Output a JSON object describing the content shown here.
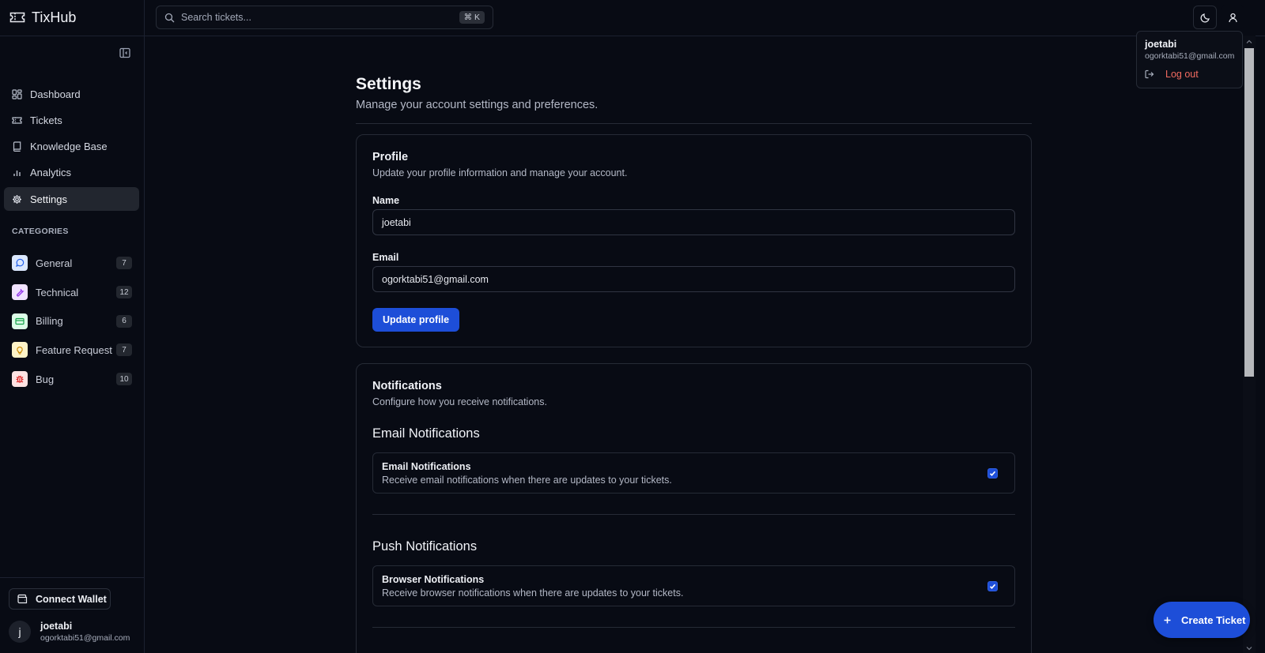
{
  "app": {
    "name": "TixHub"
  },
  "search": {
    "placeholder": "Search tickets...",
    "shortcut": "⌘ K"
  },
  "sidebar": {
    "items": [
      {
        "label": "Dashboard",
        "icon": "grid-icon"
      },
      {
        "label": "Tickets",
        "icon": "ticket-icon"
      },
      {
        "label": "Knowledge Base",
        "icon": "book-icon"
      },
      {
        "label": "Analytics",
        "icon": "bar-chart-icon"
      },
      {
        "label": "Settings",
        "icon": "gear-icon",
        "active": true
      }
    ],
    "categories_title": "CATEGORIES",
    "categories": [
      {
        "label": "General",
        "count": "7",
        "color": "#3b82f6"
      },
      {
        "label": "Technical",
        "count": "12",
        "color": "#a855f7"
      },
      {
        "label": "Billing",
        "count": "6",
        "color": "#22c55e"
      },
      {
        "label": "Feature Request",
        "count": "7",
        "color": "#eab308"
      },
      {
        "label": "Bug",
        "count": "10",
        "color": "#ef4444"
      }
    ],
    "wallet_button": "Connect Wallet",
    "user": {
      "initial": "j",
      "name": "joetabi",
      "email": "ogorktabi51@gmail.com"
    }
  },
  "dropdown": {
    "name": "joetabi",
    "email": "ogorktabi51@gmail.com",
    "logout": "Log out"
  },
  "page": {
    "title": "Settings",
    "subtitle": "Manage your account settings and preferences."
  },
  "profile": {
    "title": "Profile",
    "desc": "Update your profile information and manage your account.",
    "name_label": "Name",
    "name_value": "joetabi",
    "email_label": "Email",
    "email_value": "ogorktabi51@gmail.com",
    "button": "Update profile"
  },
  "notifications": {
    "title": "Notifications",
    "desc": "Configure how you receive notifications.",
    "email_section": "Email Notifications",
    "email_item_title": "Email Notifications",
    "email_item_desc": "Receive email notifications when there are updates to your tickets.",
    "email_checked": true,
    "push_section": "Push Notifications",
    "push_item_title": "Browser Notifications",
    "push_item_desc": "Receive browser notifications when there are updates to your tickets.",
    "push_checked": true
  },
  "fab": {
    "label": "Create Ticket"
  }
}
